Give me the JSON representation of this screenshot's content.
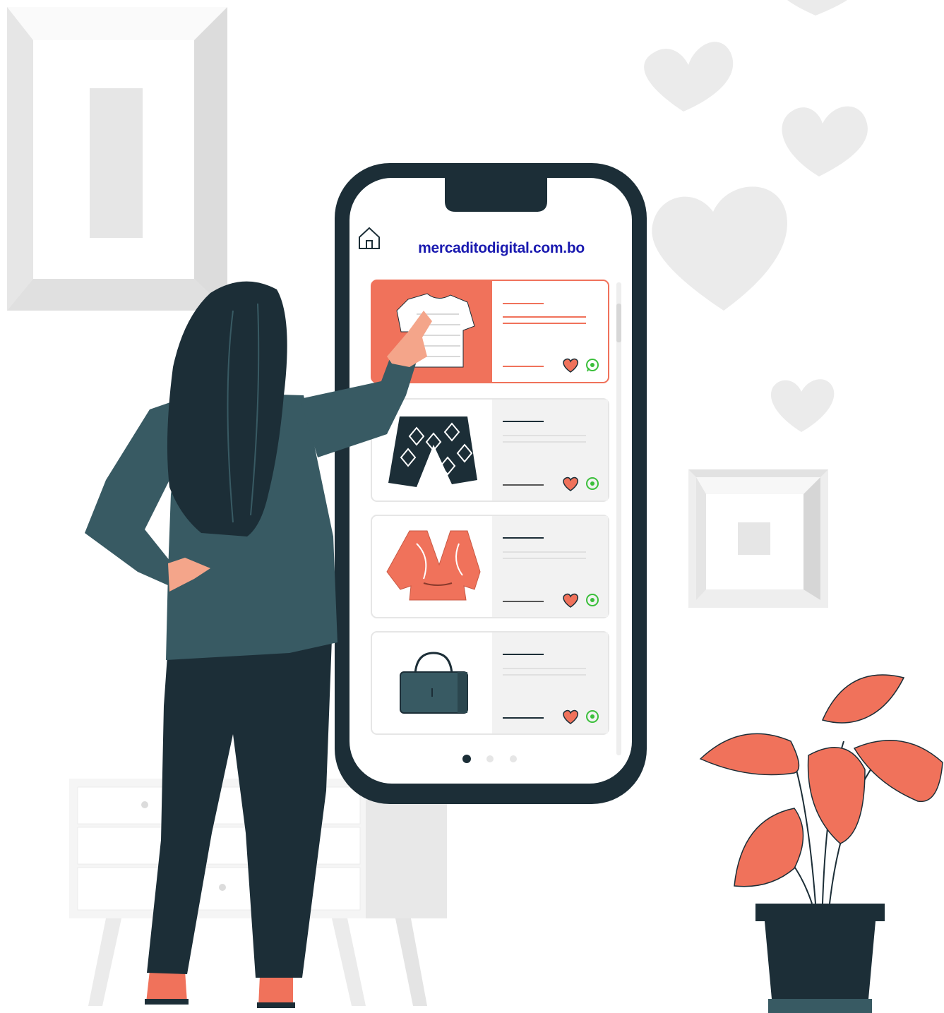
{
  "app": {
    "site_url": "mercaditodigital.com.bo",
    "home_icon": "home-icon"
  },
  "product_list": {
    "items": [
      {
        "product": "t-shirt",
        "selected": true,
        "icons": [
          "heart-icon",
          "whatsapp-icon"
        ]
      },
      {
        "product": "shorts",
        "selected": false,
        "icons": [
          "heart-icon",
          "whatsapp-icon"
        ]
      },
      {
        "product": "blouse",
        "selected": false,
        "icons": [
          "heart-icon",
          "whatsapp-icon"
        ]
      },
      {
        "product": "handbag",
        "selected": false,
        "icons": [
          "heart-icon",
          "whatsapp-icon"
        ]
      }
    ]
  },
  "pagination": {
    "pages": 3,
    "active": 1
  },
  "colors": {
    "accent": "#f0725b",
    "dark": "#1c2e37",
    "jacket": "#385a63",
    "link": "#1a1ab0",
    "whatsapp": "#3bbf3b",
    "background_gray": "#ebebeb"
  }
}
